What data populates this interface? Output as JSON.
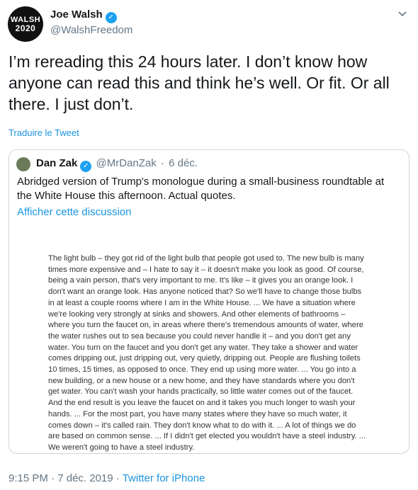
{
  "author": {
    "avatar_line1": "WALSH",
    "avatar_line2": "2020",
    "name": "Joe Walsh",
    "handle": "@WalshFreedom"
  },
  "tweet": {
    "text": "I’m rereading this 24 hours later. I don’t know how anyone can read this and think he’s well. Or fit. Or all there. I just don’t.",
    "translate_label": "Traduire le Tweet"
  },
  "quoted": {
    "name": "Dan Zak",
    "handle": "@MrDanZak",
    "separator": "·",
    "date": "6 déc.",
    "text": "Abridged version of Trump's monologue during a small-business roundtable at the White House this afternoon. Actual quotes.",
    "show_thread_label": "Afficher cette discussion",
    "image_text": "The light bulb – they got rid of the light bulb that people got used to. The new bulb is many times more expensive and – I hate to say it – it doesn't make you look as good. Of course, being a vain person, that's very important to me. It's like – it gives you an orange look. I don't want an orange look. Has anyone noticed that? So we'll have to change those bulbs in at least a couple rooms where I am in the White House. ... We have a situation where we're looking very strongly at sinks and showers. And other elements of bathrooms – where you turn the faucet on, in areas where there's tremendous amounts of water, where the water rushes out to sea because you could never handle it – and you don't get any water. You turn on the faucet and you don't get any water. They take a shower and water comes dripping out, just dripping out, very quietly, dripping out. People are flushing toilets 10 times, 15 times, as opposed to once. They end up using more water. ... You go into a new building, or a new house or a new home, and they have standards where you don't get water. You can't wash your hands practically, so little water comes out of the faucet. And the end result is you leave the faucet on and it takes you much longer to wash your hands. ... For the most part, you have many states where they have so much water, it comes down – it's called rain. They don't know what to do with it. ... A lot of things we do are based on common sense. ... If I didn't get elected you wouldn't have a steel industry. ... We weren't going to have a steel industry."
  },
  "footer": {
    "time": "9:15 PM",
    "separator": "·",
    "date": "7 déc. 2019",
    "source": "Twitter for iPhone"
  },
  "icons": {
    "verified": "verified-badge-icon",
    "menu": "chevron-down-icon"
  },
  "colors": {
    "link": "#1b95e0",
    "verified": "#1da1f2",
    "muted": "#657786"
  }
}
